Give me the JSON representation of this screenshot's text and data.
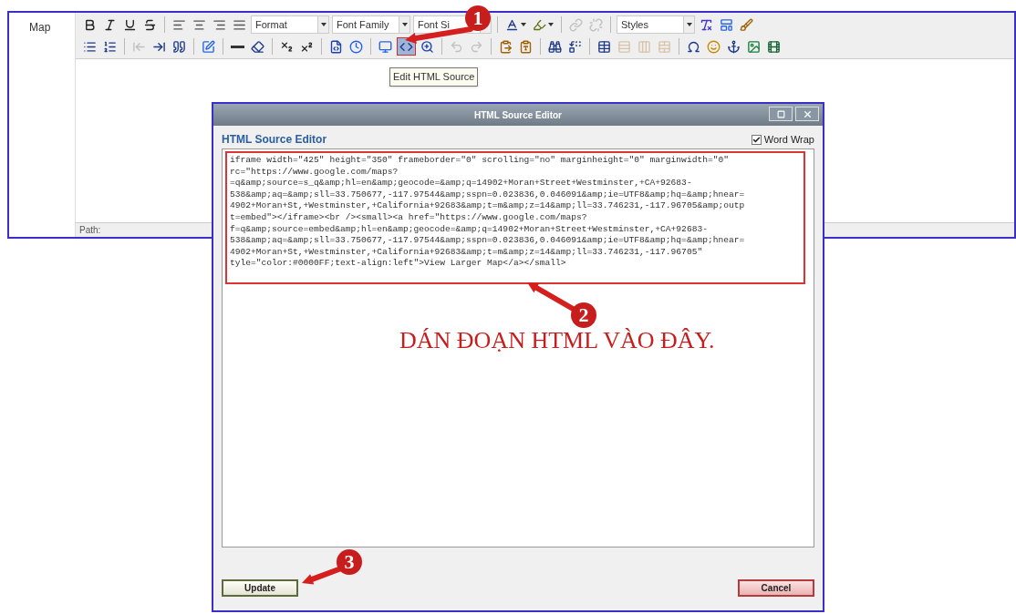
{
  "editor": {
    "field_label": "Map",
    "toolbar_rows": [
      [
        {
          "kind": "button",
          "disabled": false
        },
        {
          "kind": "button",
          "disabled": false
        },
        {
          "kind": "button",
          "disabled": false
        },
        {
          "kind": "button",
          "disabled": false
        },
        {
          "kind": "separator"
        },
        {
          "kind": "button",
          "disabled": false
        },
        {
          "kind": "button",
          "disabled": false
        },
        {
          "kind": "button",
          "disabled": false
        },
        {
          "kind": "button",
          "disabled": false
        },
        {
          "kind": "select",
          "label": "Format"
        },
        {
          "kind": "select",
          "label": "Font Family"
        },
        {
          "kind": "select",
          "label": "Font Si"
        },
        {
          "kind": "separator"
        },
        {
          "kind": "split",
          "disabled": false
        },
        {
          "kind": "split",
          "disabled": false
        },
        {
          "kind": "separator"
        },
        {
          "kind": "button",
          "disabled": true
        },
        {
          "kind": "button",
          "disabled": true
        },
        {
          "kind": "separator"
        },
        {
          "kind": "select",
          "label": "Styles"
        },
        {
          "kind": "button",
          "disabled": false
        },
        {
          "kind": "button",
          "disabled": false
        },
        {
          "kind": "button",
          "disabled": false
        }
      ],
      [
        {
          "kind": "button",
          "disabled": false
        },
        {
          "kind": "button",
          "disabled": false
        },
        {
          "kind": "separator"
        },
        {
          "kind": "button",
          "disabled": true
        },
        {
          "kind": "button",
          "disabled": false
        },
        {
          "kind": "button",
          "disabled": false
        },
        {
          "kind": "separator"
        },
        {
          "kind": "button",
          "disabled": false
        },
        {
          "kind": "separator"
        },
        {
          "kind": "button",
          "disabled": false
        },
        {
          "kind": "button",
          "disabled": false
        },
        {
          "kind": "separator"
        },
        {
          "kind": "button",
          "disabled": false
        },
        {
          "kind": "button",
          "disabled": false
        },
        {
          "kind": "separator"
        },
        {
          "kind": "button",
          "disabled": false
        },
        {
          "kind": "button",
          "disabled": false
        },
        {
          "kind": "separator"
        },
        {
          "kind": "button",
          "disabled": false
        },
        {
          "kind": "button",
          "disabled": false
        },
        {
          "kind": "button",
          "disabled": false
        },
        {
          "kind": "separator"
        },
        {
          "kind": "button",
          "disabled": true
        },
        {
          "kind": "button",
          "disabled": true
        },
        {
          "kind": "separator"
        },
        {
          "kind": "button",
          "disabled": false
        },
        {
          "kind": "button",
          "disabled": false
        },
        {
          "kind": "separator"
        },
        {
          "kind": "button",
          "disabled": false
        },
        {
          "kind": "button",
          "disabled": false
        },
        {
          "kind": "separator"
        },
        {
          "kind": "button",
          "disabled": false
        },
        {
          "kind": "button",
          "disabled": true
        },
        {
          "kind": "button",
          "disabled": true
        },
        {
          "kind": "button",
          "disabled": true
        },
        {
          "kind": "separator"
        },
        {
          "kind": "button",
          "disabled": false
        },
        {
          "kind": "button",
          "disabled": false
        },
        {
          "kind": "button",
          "disabled": false
        },
        {
          "kind": "button",
          "disabled": false
        },
        {
          "kind": "button",
          "disabled": false
        }
      ]
    ],
    "tooltip": "Edit HTML Source",
    "status_bar": "Path:"
  },
  "dialog": {
    "title": "HTML Source Editor",
    "heading": "HTML Source Editor",
    "word_wrap": {
      "label": "Word Wrap",
      "checked": true
    },
    "source_lines": [
      "iframe width=\"425\" height=\"350\" frameborder=\"0\" scrolling=\"no\" marginheight=\"0\" marginwidth=\"0\"",
      "rc=\"https://www.google.com/maps?",
      "=q&amp;source=s_q&amp;hl=en&amp;geocode=&amp;q=14902+Moran+Street+Westminster,+CA+92683-",
      "538&amp;aq=&amp;sll=33.750677,-117.97544&amp;sspn=0.023836,0.046091&amp;ie=UTF8&amp;hq=&amp;hnear=",
      "4902+Moran+St,+Westminster,+California+92683&amp;t=m&amp;z=14&amp;ll=33.746231,-117.96705&amp;outp",
      "t=embed\"></iframe><br /><small><a href=\"https://www.google.com/maps?",
      "f=q&amp;source=embed&amp;hl=en&amp;geocode=&amp;q=14902+Moran+Street+Westminster,+CA+92683-",
      "538&amp;aq=&amp;sll=33.750677,-117.97544&amp;sspn=0.023836,0.046091&amp;ie=UTF8&amp;hq=&amp;hnear=",
      "4902+Moran+St,+Westminster,+California+92683&amp;t=m&amp;z=14&amp;ll=33.746231,-117.96705\"",
      "tyle=\"color:#0000FF;text-align:left\">View Larger Map</a></small>"
    ],
    "buttons": [
      {
        "label": "Update",
        "kind": "primary"
      },
      {
        "label": "Cancel",
        "kind": "cancel"
      }
    ]
  },
  "annotations": {
    "step_numbers": [
      "1",
      "2",
      "3"
    ],
    "instruction": "DÁN ĐOẠN HTML VÀO ĐÂY."
  }
}
